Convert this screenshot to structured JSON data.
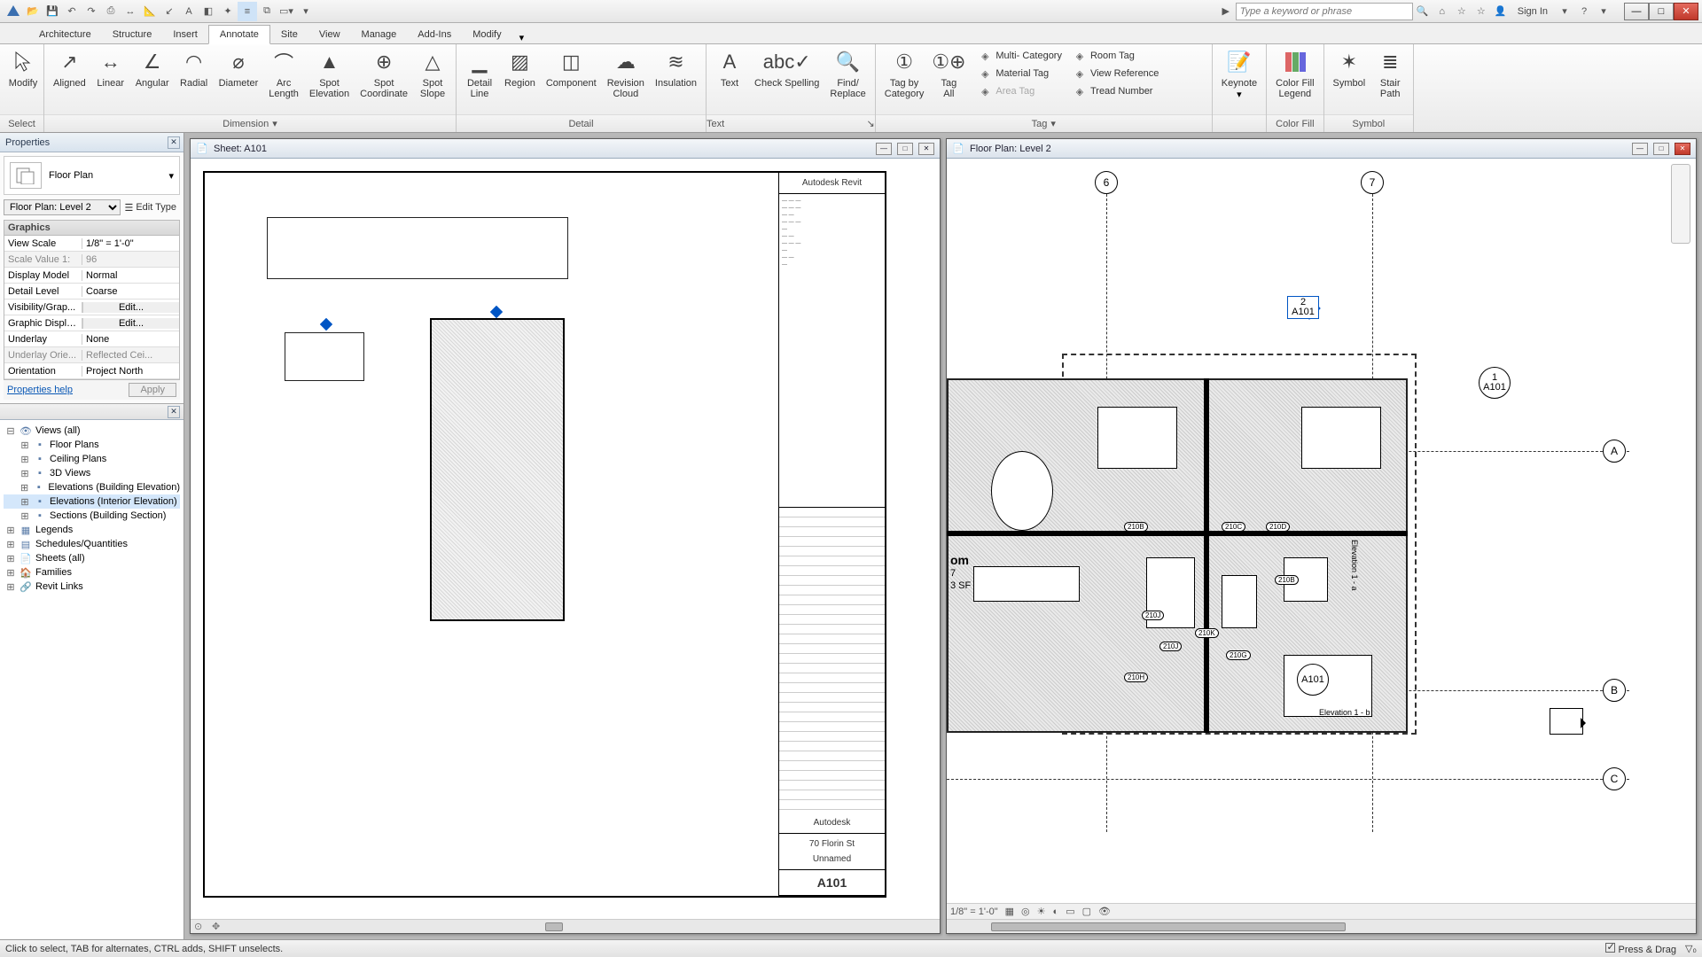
{
  "qat": {
    "search_placeholder": "Type a keyword or phrase",
    "signin": "Sign In"
  },
  "tabs": [
    "Architecture",
    "Structure",
    "Insert",
    "Annotate",
    "Site",
    "View",
    "Manage",
    "Add-Ins",
    "Modify"
  ],
  "active_tab": "Annotate",
  "ribbon": {
    "select": {
      "modify": "Modify",
      "title": "Select"
    },
    "dimension": {
      "title": "Dimension",
      "items": [
        "Aligned",
        "Linear",
        "Angular",
        "Radial",
        "Diameter",
        "Arc\nLength",
        "Spot\nElevation",
        "Spot\nCoordinate",
        "Spot\nSlope"
      ]
    },
    "detail": {
      "title": "Detail",
      "items": [
        "Detail\nLine",
        "Region",
        "Component",
        "Revision\nCloud",
        "Insulation"
      ]
    },
    "text": {
      "title": "Text",
      "items": [
        "Text",
        "Check Spelling",
        "Find/\nReplace"
      ]
    },
    "tag": {
      "title": "Tag",
      "big": [
        "Tag by\nCategory",
        "Tag\nAll"
      ],
      "rows": [
        {
          "l": "Multi- Category",
          "r": "Room  Tag"
        },
        {
          "l": "Material  Tag",
          "r": "View  Reference"
        },
        {
          "l": "Area  Tag",
          "r": "Tread  Number",
          "disabled": true
        }
      ]
    },
    "keynote": {
      "label": "Keynote"
    },
    "colorfill": {
      "label": "Color Fill\nLegend",
      "title": "Color Fill"
    },
    "symbol": {
      "items": [
        "Symbol",
        "Stair\nPath"
      ],
      "title": "Symbol"
    }
  },
  "properties": {
    "title": "Properties",
    "family": "Floor Plan",
    "instance": "Floor Plan: Level 2",
    "edit_type": "Edit Type",
    "group": "Graphics",
    "rows": [
      {
        "k": "View Scale",
        "v": "1/8\" = 1'-0\"",
        "editable": true
      },
      {
        "k": "Scale Value    1:",
        "v": "96",
        "ro": true
      },
      {
        "k": "Display Model",
        "v": "Normal"
      },
      {
        "k": "Detail Level",
        "v": "Coarse"
      },
      {
        "k": "Visibility/Grap...",
        "v": "Edit...",
        "btn": true
      },
      {
        "k": "Graphic Displa...",
        "v": "Edit...",
        "btn": true
      },
      {
        "k": "Underlay",
        "v": "None"
      },
      {
        "k": "Underlay Orie...",
        "v": "Reflected Cei...",
        "ro": true
      },
      {
        "k": "Orientation",
        "v": "Project North"
      }
    ],
    "help": "Properties help",
    "apply": "Apply"
  },
  "browser": {
    "nodes": [
      {
        "t": "Views (all)",
        "lvl": 0,
        "exp": true,
        "ic": "views"
      },
      {
        "t": "Floor Plans",
        "lvl": 1,
        "ic": "plan"
      },
      {
        "t": "Ceiling Plans",
        "lvl": 1,
        "ic": "plan"
      },
      {
        "t": "3D Views",
        "lvl": 1,
        "ic": "plan"
      },
      {
        "t": "Elevations (Building Elevation)",
        "lvl": 1,
        "ic": "plan"
      },
      {
        "t": "Elevations (Interior Elevation)",
        "lvl": 1,
        "ic": "plan",
        "sel": true
      },
      {
        "t": "Sections (Building Section)",
        "lvl": 1,
        "ic": "plan"
      },
      {
        "t": "Legends",
        "lvl": 0,
        "ic": "legend"
      },
      {
        "t": "Schedules/Quantities",
        "lvl": 0,
        "ic": "sched"
      },
      {
        "t": "Sheets (all)",
        "lvl": 0,
        "ic": "sheet"
      },
      {
        "t": "Families",
        "lvl": 0,
        "ic": "fam"
      },
      {
        "t": "Revit Links",
        "lvl": 0,
        "ic": "link"
      }
    ]
  },
  "views": {
    "left": {
      "title": "Sheet: A101",
      "titleblock": {
        "app": "Autodesk Revit",
        "owner": "Autodesk",
        "addr": "70 Florin St",
        "proj": "Unnamed",
        "sheet": "A101"
      }
    },
    "right": {
      "title": "Floor Plan: Level 2",
      "grids_v": [
        "6",
        "7"
      ],
      "grids_h": [
        "A",
        "B",
        "C"
      ],
      "callouts": [
        {
          "n": "2",
          "s": "A101"
        },
        {
          "n": "1",
          "s": "A101"
        }
      ],
      "scale": "1/8\" = 1'-0\"",
      "elev_label": "Elevation 1 - b",
      "room": "om"
    }
  },
  "status": {
    "hint": "Click to select, TAB for alternates, CTRL adds, SHIFT unselects.",
    "pressdrag": "Press & Drag"
  }
}
